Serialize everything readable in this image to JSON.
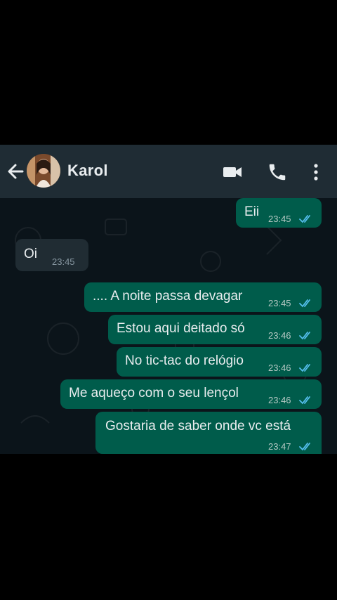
{
  "header": {
    "contact_name": "Karol"
  },
  "colors": {
    "header_bg": "#1f2c34",
    "chat_bg": "#0b141a",
    "outgoing_bubble": "#005c4b",
    "incoming_bubble": "#202c33",
    "read_ticks": "#53bdeb"
  },
  "icons": [
    "arrow-left-icon",
    "avatar",
    "video-camera-icon",
    "phone-icon",
    "more-vertical-icon",
    "double-check-icon"
  ],
  "messages": [
    {
      "direction": "out",
      "text": "Eii",
      "time": "23:45",
      "status": "read"
    },
    {
      "direction": "in",
      "text": "Oi",
      "time": "23:45"
    },
    {
      "direction": "out",
      "text": ".... A noite passa devagar",
      "time": "23:45",
      "status": "read"
    },
    {
      "direction": "out",
      "text": "Estou aqui deitado só",
      "time": "23:46",
      "status": "read"
    },
    {
      "direction": "out",
      "text": "No tic-tac do relógio",
      "time": "23:46",
      "status": "read"
    },
    {
      "direction": "out",
      "text": "Me aqueço com o seu lençol",
      "time": "23:46",
      "status": "read"
    },
    {
      "direction": "out",
      "text": "Gostaria de saber onde vc está",
      "time": "23:47",
      "status": "read"
    }
  ]
}
